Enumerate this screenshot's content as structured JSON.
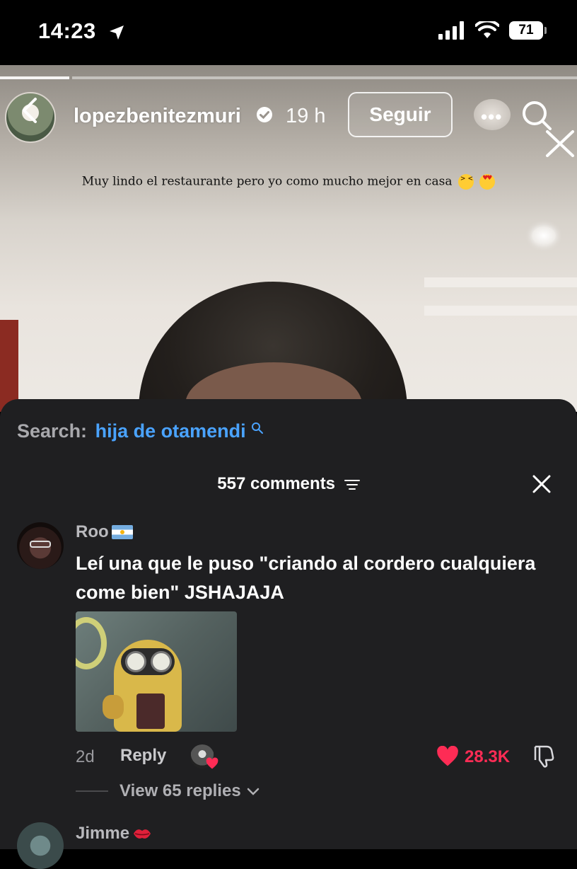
{
  "status_bar": {
    "time": "14:23",
    "battery": "71"
  },
  "story": {
    "username": "lopezbenitezmuri",
    "time_ago": "19 h",
    "follow_label": "Seguir",
    "more_label": "•••",
    "caption": "Muy lindo el restaurante pero yo como mucho mejor en casa",
    "progress": 0.12
  },
  "sheet": {
    "search_label": "Search:",
    "search_query": "hija de otamendi",
    "comments_count_label": "557 comments"
  },
  "comments": [
    {
      "author": "Roo",
      "text": "Leí una que le puso \"criando al cordero cualquiera come bien\" JSHAJAJA",
      "age": "2d",
      "reply_label": "Reply",
      "likes": "28.3K",
      "view_replies": "View 65 replies"
    },
    {
      "author": "Jimme"
    }
  ],
  "colors": {
    "accent_blue": "#4aa3ff",
    "like_red": "#fe2c55",
    "sheet_bg": "#1f1f21"
  },
  "icons": [
    "location-arrow-icon",
    "signal-icon",
    "wifi-icon",
    "battery-icon",
    "back-chevron-icon",
    "verified-icon",
    "more-icon",
    "search-icon",
    "close-icon",
    "filter-icon",
    "heart-icon",
    "dislike-icon",
    "chevron-down-icon"
  ]
}
